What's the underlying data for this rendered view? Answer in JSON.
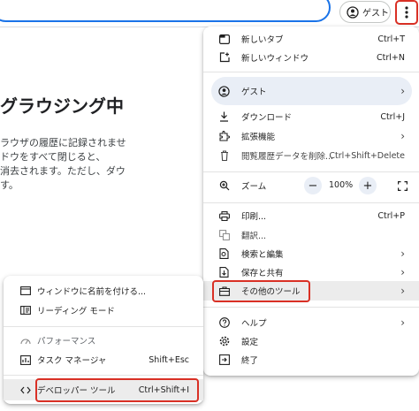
{
  "toolbar": {
    "guest_label": "ゲスト",
    "menu_icon": "more-vert-icon"
  },
  "page": {
    "title": "グラウジング中",
    "lines": [
      "ラウザの履歴に記録されませ",
      "ドウをすべて閉じると、",
      "消去されます。ただし、ダウ",
      "す。"
    ]
  },
  "menu": {
    "new_tab": {
      "label": "新しいタブ",
      "shortcut": "Ctrl+T"
    },
    "new_window": {
      "label": "新しいウィンドウ",
      "shortcut": "Ctrl+N"
    },
    "guest": {
      "label": "ゲスト"
    },
    "downloads": {
      "label": "ダウンロード",
      "shortcut": "Ctrl+J"
    },
    "extensions": {
      "label": "拡張機能"
    },
    "clear_data": {
      "label": "閲覧履歴データを削除...",
      "shortcut": "Ctrl+Shift+Delete"
    },
    "zoom": {
      "label": "ズーム",
      "value": "100%",
      "minus": "−",
      "plus": "+"
    },
    "print": {
      "label": "印刷...",
      "shortcut": "Ctrl+P"
    },
    "translate": {
      "label": "翻訳..."
    },
    "search_edit": {
      "label": "検索と編集"
    },
    "save_share": {
      "label": "保存と共有"
    },
    "more_tools": {
      "label": "その他のツール"
    },
    "help": {
      "label": "ヘルプ"
    },
    "settings": {
      "label": "設定"
    },
    "exit": {
      "label": "終了"
    }
  },
  "submenu": {
    "name_window": {
      "label": "ウィンドウに名前を付ける..."
    },
    "reading_mode": {
      "label": "リーディング モード"
    },
    "performance": {
      "label": "パフォーマンス"
    },
    "task_manager": {
      "label": "タスク マネージャ",
      "shortcut": "Shift+Esc"
    },
    "devtools": {
      "label": "デベロッパー ツール",
      "shortcut": "Ctrl+Shift+I"
    }
  },
  "colors": {
    "accent": "#1a73e8",
    "highlight": "#d93025",
    "guest_bg": "#e9eef6"
  }
}
